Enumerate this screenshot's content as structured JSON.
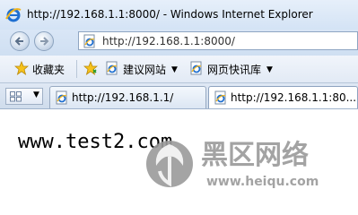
{
  "window": {
    "title": "http://192.168.1.1:8000/ - Windows Internet Explorer"
  },
  "navigation": {
    "address_url": "http://192.168.1.1:8000/",
    "back_icon": "back-arrow-icon",
    "forward_icon": "forward-arrow-icon"
  },
  "favorites_bar": {
    "favorites_label": "收藏夹",
    "items": [
      {
        "label": "建议网站",
        "icon": "ie-page-icon"
      },
      {
        "label": "网页快讯库",
        "icon": "ie-page-icon"
      }
    ]
  },
  "tabs": [
    {
      "label": "http://192.168.1.1/",
      "active": false
    },
    {
      "label": "http://192.168.1.1:80...",
      "active": true
    }
  ],
  "content": {
    "body_text": "www.test2.com"
  },
  "watermark": {
    "brand_text": "黑区网络",
    "url_text": "www.heiqu.com"
  },
  "colors": {
    "ie_blue": "#1f6fd0",
    "ie_gold": "#f2b51c",
    "watermark_gray": "#9a9a9a"
  }
}
